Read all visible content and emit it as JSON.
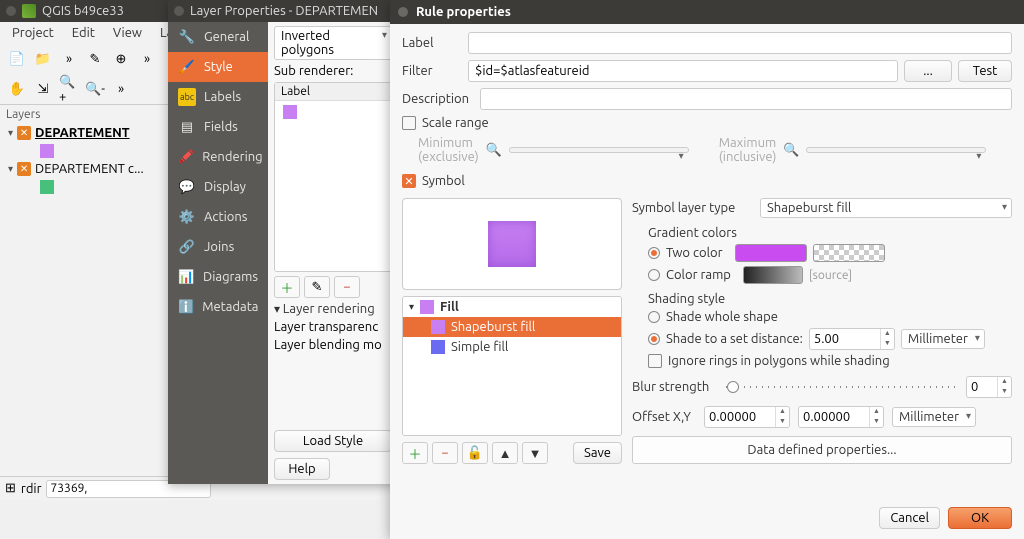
{
  "qgis": {
    "title": "QGIS b49ce33",
    "menubar": [
      "Project",
      "Edit",
      "View",
      "Laye"
    ],
    "statusbar": {
      "rdir_label": "rdir",
      "coords": "73369,"
    },
    "layers_panel": {
      "title": "Layers",
      "items": [
        {
          "name": "DEPARTEMENT",
          "swatch": "#c77ff2",
          "bold": true
        },
        {
          "name": "DEPARTEMENT c...",
          "swatch": "#47c07c",
          "bold": false
        }
      ]
    }
  },
  "layer_props": {
    "title": "Layer Properties - DEPARTEMEN",
    "side_tabs": [
      "General",
      "Style",
      "Labels",
      "Fields",
      "Rendering",
      "Display",
      "Actions",
      "Joins",
      "Diagrams",
      "Metadata"
    ],
    "active_tab_index": 1,
    "renderer": "Inverted polygons",
    "sub_renderer_label": "Sub renderer:",
    "sub_list_header": "Label",
    "layer_rendering_label": "Layer rendering",
    "transparency_label": "Layer transparenc",
    "blending_label": "Layer blending mo",
    "load_style": "Load Style",
    "help": "Help"
  },
  "rule": {
    "title": "Rule properties",
    "labels": {
      "label": "Label",
      "filter": "Filter",
      "description": "Description",
      "scale_range": "Scale range",
      "minimum": "Minimum\n(exclusive)",
      "maximum": "Maximum\n(inclusive)",
      "symbol": "Symbol",
      "symbol_layer_type": "Symbol layer type",
      "gradient_colors": "Gradient colors",
      "two_color": "Two color",
      "color_ramp": "Color ramp",
      "source_hint": "[source]",
      "shading_style": "Shading style",
      "shade_whole": "Shade whole shape",
      "shade_distance": "Shade to a set distance:",
      "ignore_rings": "Ignore rings in polygons while shading",
      "blur_strength": "Blur strength",
      "offset_xy": "Offset X,Y",
      "data_defined": "Data defined properties...",
      "cancel": "Cancel",
      "ok": "OK",
      "ellipsis": "...",
      "test": "Test",
      "save": "Save"
    },
    "values": {
      "label": "",
      "filter": "$id=$atlasfeatureid",
      "description": "",
      "scale_range_checked": false,
      "symbol_checked": true,
      "symbol_layer_type": "Shapeburst fill",
      "two_color_selected": true,
      "color_ramp_selected": false,
      "color1": "#c84cf0",
      "shade_whole_selected": false,
      "shade_distance_selected": true,
      "shade_distance": "5.00",
      "shade_unit": "Millimeter",
      "ignore_rings": false,
      "blur_strength": "0",
      "offset_x": "0.00000",
      "offset_y": "0.00000",
      "offset_unit": "Millimeter"
    },
    "symbol_layers": {
      "fill_label": "Fill",
      "items": [
        {
          "name": "Shapeburst fill",
          "color": "#c77ff2",
          "selected": true
        },
        {
          "name": "Simple fill",
          "color": "#6a6af2",
          "selected": false
        }
      ]
    }
  }
}
